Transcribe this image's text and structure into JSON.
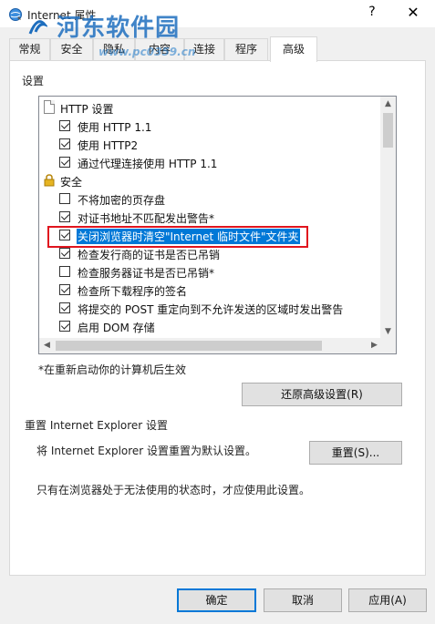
{
  "window": {
    "title": "Internet 属性",
    "help_glyph": "?",
    "close_glyph": "✕"
  },
  "watermark": {
    "text": "河东软件园",
    "url": "www.pc0359.cn"
  },
  "tabs": [
    {
      "label": "常规"
    },
    {
      "label": "安全"
    },
    {
      "label": "隐私"
    },
    {
      "label": "内容"
    },
    {
      "label": "连接"
    },
    {
      "label": "程序"
    },
    {
      "label": "高级"
    }
  ],
  "settings": {
    "group_label": "设置",
    "items": [
      {
        "type": "category",
        "icon": "document-icon",
        "label": "HTTP 设置"
      },
      {
        "type": "option",
        "checked": true,
        "label": "使用 HTTP 1.1"
      },
      {
        "type": "option",
        "checked": true,
        "label": "使用 HTTP2"
      },
      {
        "type": "option",
        "checked": true,
        "label": "通过代理连接使用 HTTP 1.1"
      },
      {
        "type": "category",
        "icon": "lock-icon",
        "label": "安全"
      },
      {
        "type": "option",
        "checked": false,
        "label": "不将加密的页存盘"
      },
      {
        "type": "option",
        "checked": true,
        "label": "对证书地址不匹配发出警告*"
      },
      {
        "type": "option",
        "checked": true,
        "label": "关闭浏览器时清空\"Internet 临时文件\"文件夹",
        "selected": true
      },
      {
        "type": "option",
        "checked": true,
        "label": "检查发行商的证书是否已吊销"
      },
      {
        "type": "option",
        "checked": false,
        "label": "检查服务器证书是否已吊销*"
      },
      {
        "type": "option",
        "checked": true,
        "label": "检查所下载程序的签名"
      },
      {
        "type": "option",
        "checked": true,
        "label": "将提交的 POST 重定向到不允许发送的区域时发出警告"
      },
      {
        "type": "option",
        "checked": true,
        "label": "启用 DOM 存储"
      }
    ],
    "restart_note": "*在重新启动你的计算机后生效",
    "restore_button": "还原高级设置(R)"
  },
  "reset": {
    "title": "重置 Internet Explorer 设置",
    "description": "将 Internet Explorer 设置重置为默认设置。",
    "button": "重置(S)...",
    "warning": "只有在浏览器处于无法使用的状态时，才应使用此设置。"
  },
  "footer": {
    "ok": "确定",
    "cancel": "取消",
    "apply": "应用(A)"
  },
  "colors": {
    "selection": "#0078d7",
    "annotation_box": "#e0141e",
    "watermark": "#1e6ebe"
  }
}
